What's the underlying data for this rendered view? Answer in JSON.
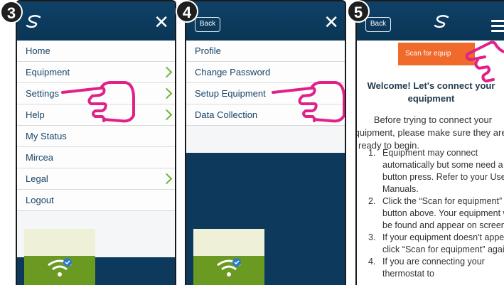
{
  "steps": {
    "s1": "3",
    "s2": "4",
    "s3": "5"
  },
  "screen1": {
    "close_label": "✕",
    "menu": [
      {
        "label": "Home",
        "chevron": false
      },
      {
        "label": "Equipment",
        "chevron": true
      },
      {
        "label": "Settings",
        "chevron": true
      },
      {
        "label": "Help",
        "chevron": true
      },
      {
        "label": "My Status",
        "chevron": false
      },
      {
        "label": "Mircea",
        "chevron": false
      },
      {
        "label": "Legal",
        "chevron": true
      },
      {
        "label": "Logout",
        "chevron": false
      }
    ]
  },
  "screen2": {
    "back_label": "Back",
    "close_label": "✕",
    "menu": [
      {
        "label": "Profile"
      },
      {
        "label": "Change Password"
      },
      {
        "label": "Setup Equipment"
      },
      {
        "label": "Data Collection"
      }
    ]
  },
  "screen3": {
    "back_label": "Back",
    "scan_button": "Scan for equip",
    "welcome_line1": "Welcome! Let's connect your",
    "welcome_line2": "equipment",
    "para_line1": "Before trying to connect your",
    "para_line2": "equipment, please make sure they are",
    "para_line3": "ready to begin.",
    "steps": [
      {
        "num": "1.",
        "lines": [
          "Equipment may connect",
          "automatically but some need a",
          "button press. Refer to your User",
          "Manuals."
        ]
      },
      {
        "num": "2.",
        "lines": [
          "Click the “Scan for equipment”",
          "button above. Your equipment wi",
          "be found and appear on screen."
        ]
      },
      {
        "num": "3.",
        "lines": [
          "If your equipment doesn't appear",
          "click “Scan for equipment” again."
        ]
      },
      {
        "num": "4.",
        "lines": [
          "If you are connecting your",
          "thermostat to"
        ]
      }
    ]
  },
  "colors": {
    "header": "#0d3a5c",
    "accent_green": "#69b53a",
    "hand": "#e0218a",
    "scan_orange": "#ef6a2b"
  }
}
